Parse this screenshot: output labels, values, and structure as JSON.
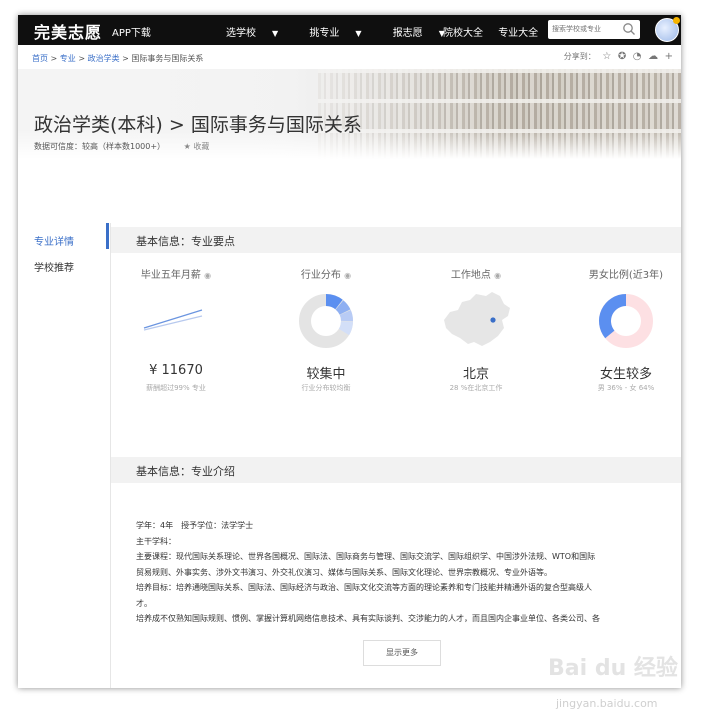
{
  "nav": {
    "logo": "完美志愿",
    "app": "APP下载",
    "menu": [
      "选学校",
      "挑专业",
      "报志愿"
    ],
    "right": [
      "院校大全",
      "专业大全"
    ],
    "search_placeholder": "搜索学校或专业"
  },
  "breadcrumb": {
    "items": [
      "首页",
      "专业",
      "政治学类"
    ],
    "current": "国际事务与国际关系",
    "sep": ">",
    "share_label": "分享到："
  },
  "hero": {
    "title": "政治学类(本科) > 国际事务与国际关系",
    "credibility": "数据可信度：较高（样本数1000+）",
    "fav": "收藏"
  },
  "sidebar": {
    "items": [
      "专业详情",
      "学校推荐"
    ]
  },
  "section1": {
    "title": "基本信息：专业要点",
    "stats": [
      {
        "label": "毕业五年月薪",
        "value": "¥ 11670",
        "note": "薪酬超过99% 专业"
      },
      {
        "label": "行业分布",
        "value": "较集中",
        "note": "行业分布较均衡"
      },
      {
        "label": "工作地点",
        "value": "北京",
        "note": "28 %在北京工作"
      },
      {
        "label": "男女比例(近3年)",
        "value": "女生较多",
        "note": "男 36% - 女 64%"
      }
    ],
    "gender": {
      "male_pct": 36,
      "female_pct": 64
    }
  },
  "section2": {
    "title": "基本信息：专业介绍",
    "lines": [
      "学年：4年　授予学位：法学学士",
      "主干学科：",
      "主要课程：现代国际关系理论、世界各国概况、国际法、国际商务与管理、国际交流学、国际组织学、中国涉外法规、WTO和国际",
      "贸易规则、外事实务、涉外文书演习、外交礼仪演习、媒体与国际关系、国际文化理论、世界宗教概况、专业外语等。",
      "培养目标：培养通晓国际关系、国际法、国际经济与政治、国际文化交流等方面的理论素养和专门技能并精通外语的复合型高级人",
      "才。",
      "培养成不仅熟知国际规则、惯例、掌握计算机网络信息技术、具有实际谈判、交涉能力的人才，而且国内企事业单位、各类公司、各"
    ],
    "more": "显示更多"
  },
  "watermark": {
    "main": "Bai du 经验",
    "sub": "jingyan.baidu.com"
  },
  "colors": {
    "accent": "#3a6fc8",
    "female": "#fde0e3",
    "male": "#5b8ff0"
  }
}
